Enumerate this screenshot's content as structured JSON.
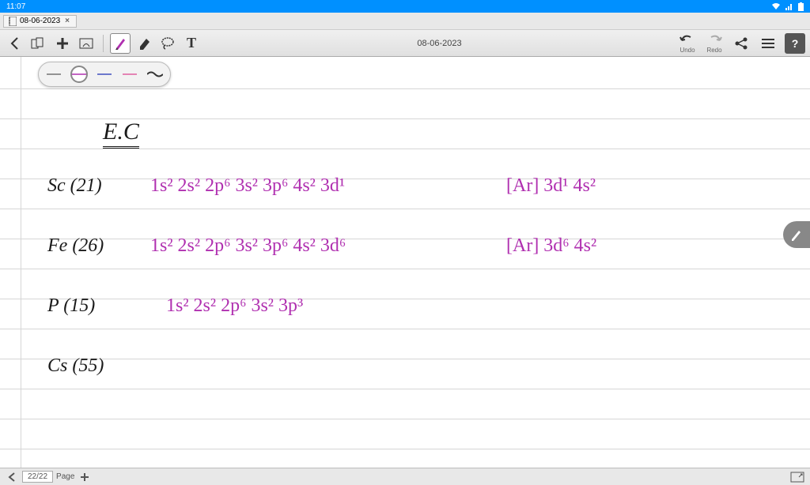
{
  "status": {
    "time": "11:07"
  },
  "tab": {
    "title": "08-06-2023"
  },
  "toolbar": {
    "title": "08-06-2023",
    "undo": "Undo",
    "redo": "Redo"
  },
  "notes": {
    "heading": "E.C",
    "rows": [
      {
        "elem": "Sc (21)",
        "config": "1s² 2s² 2p⁶ 3s² 3p⁶ 4s² 3d¹",
        "noble": "[Ar] 3d¹ 4s²"
      },
      {
        "elem": "Fe (26)",
        "config": "1s² 2s² 2p⁶ 3s² 3p⁶ 4s² 3d⁶",
        "noble": "[Ar] 3d⁶ 4s²"
      },
      {
        "elem": "P (15)",
        "config": "1s² 2s² 2p⁶ 3s² 3p³",
        "noble": ""
      },
      {
        "elem": "Cs (55)",
        "config": "",
        "noble": ""
      }
    ]
  },
  "footer": {
    "page": "22/22",
    "page_label": "Page"
  }
}
